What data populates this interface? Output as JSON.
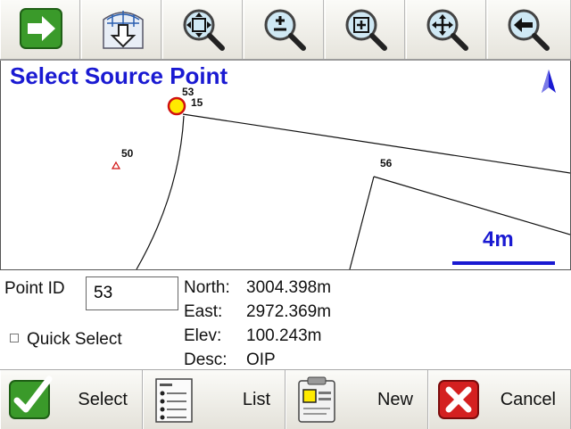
{
  "toolbar": {
    "buttons": [
      {
        "name": "next-arrow-button",
        "icon": "right-arrow-icon"
      },
      {
        "name": "import-globe-button",
        "icon": "globe-download-icon"
      },
      {
        "name": "zoom-extents-button",
        "icon": "zoom-extents-icon"
      },
      {
        "name": "zoom-in-out-button",
        "icon": "zoom-plus-minus-icon"
      },
      {
        "name": "zoom-window-button",
        "icon": "zoom-window-icon"
      },
      {
        "name": "pan-button",
        "icon": "pan-icon"
      },
      {
        "name": "back-button",
        "icon": "back-arrow-icon"
      }
    ]
  },
  "map": {
    "title": "Select Source Point",
    "scale_label": "4m",
    "title_color": "#1a1ad2",
    "points": [
      {
        "id": "53",
        "secondary": "15",
        "selected": true
      },
      {
        "id": "50"
      },
      {
        "id": "56"
      }
    ]
  },
  "info": {
    "point_id_label": "Point ID",
    "point_id_value": "53",
    "quick_select_label": "Quick Select",
    "north_label": "North:",
    "north_value": "3004.398m",
    "east_label": "East:",
    "east_value": "2972.369m",
    "elev_label": "Elev:",
    "elev_value": "100.243m",
    "desc_label": "Desc:",
    "desc_value": "OIP"
  },
  "actions": {
    "select_label": "Select",
    "list_label": "List",
    "new_label": "New",
    "cancel_label": "Cancel"
  }
}
